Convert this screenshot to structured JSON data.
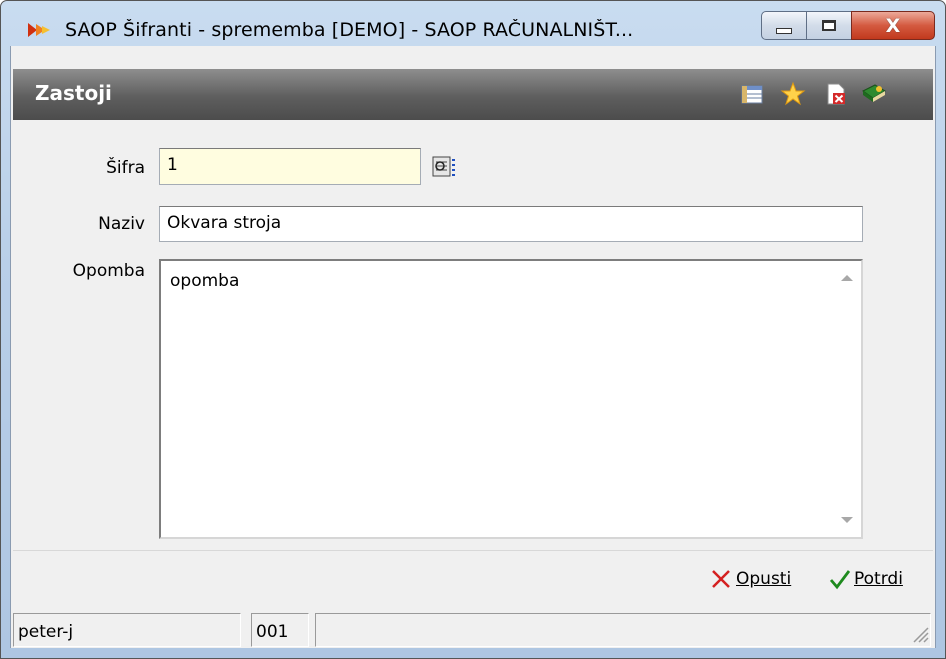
{
  "window": {
    "title": "SAOP Šifranti - sprememba [DEMO] - SAOP RAČUNALNIŠT...",
    "close_glyph": "X"
  },
  "header": {
    "title": "Zastoji",
    "icons": [
      "table-icon",
      "star-icon",
      "delete-document-icon",
      "book-exit-icon"
    ]
  },
  "form": {
    "sifra_label": "Šifra",
    "sifra_value": "1",
    "naziv_label": "Naziv",
    "naziv_value": "Okvara stroja",
    "opomba_label": "Opomba",
    "opomba_value": "opomba"
  },
  "actions": {
    "cancel_label": "Opusti",
    "confirm_label": "Potrdi"
  },
  "status": {
    "user": "peter-j",
    "code": "001",
    "extra": ""
  },
  "colors": {
    "header_bg": "#5e5e5e",
    "sifra_bg": "#fffde0",
    "cancel_x": "#d42020",
    "confirm_check": "#1e8a1e"
  }
}
